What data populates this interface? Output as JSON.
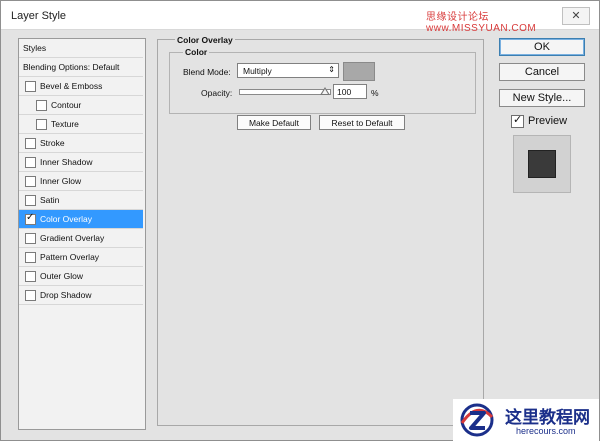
{
  "window": {
    "title": "Layer Style",
    "watermark_text": "思缘设计论坛 www.MISSYUAN.COM",
    "close_glyph": "✕"
  },
  "styles_panel": {
    "items": [
      {
        "label": "Styles",
        "checkbox": false,
        "checked": false,
        "indent": 0,
        "selected": false
      },
      {
        "label": "Blending Options: Default",
        "checkbox": false,
        "checked": false,
        "indent": 0,
        "selected": false
      },
      {
        "label": "Bevel & Emboss",
        "checkbox": true,
        "checked": false,
        "indent": 0,
        "selected": false
      },
      {
        "label": "Contour",
        "checkbox": true,
        "checked": false,
        "indent": 1,
        "selected": false
      },
      {
        "label": "Texture",
        "checkbox": true,
        "checked": false,
        "indent": 1,
        "selected": false
      },
      {
        "label": "Stroke",
        "checkbox": true,
        "checked": false,
        "indent": 0,
        "selected": false
      },
      {
        "label": "Inner Shadow",
        "checkbox": true,
        "checked": false,
        "indent": 0,
        "selected": false
      },
      {
        "label": "Inner Glow",
        "checkbox": true,
        "checked": false,
        "indent": 0,
        "selected": false
      },
      {
        "label": "Satin",
        "checkbox": true,
        "checked": false,
        "indent": 0,
        "selected": false
      },
      {
        "label": "Color Overlay",
        "checkbox": true,
        "checked": true,
        "indent": 0,
        "selected": true
      },
      {
        "label": "Gradient Overlay",
        "checkbox": true,
        "checked": false,
        "indent": 0,
        "selected": false
      },
      {
        "label": "Pattern Overlay",
        "checkbox": true,
        "checked": false,
        "indent": 0,
        "selected": false
      },
      {
        "label": "Outer Glow",
        "checkbox": true,
        "checked": false,
        "indent": 0,
        "selected": false
      },
      {
        "label": "Drop Shadow",
        "checkbox": true,
        "checked": false,
        "indent": 0,
        "selected": false
      }
    ]
  },
  "color_overlay": {
    "group_title": "Color Overlay",
    "subgroup_title": "Color",
    "blend_mode_label": "Blend Mode:",
    "blend_mode_value": "Multiply",
    "overlay_color": "#a8a8a8",
    "opacity_label": "Opacity:",
    "opacity_value": "100",
    "opacity_unit": "%",
    "make_default_label": "Make Default",
    "reset_default_label": "Reset to Default"
  },
  "actions": {
    "ok_label": "OK",
    "cancel_label": "Cancel",
    "new_style_label": "New Style...",
    "preview_label": "Preview",
    "preview_checked": true
  },
  "logo": {
    "title": "这里教程网",
    "subtitle": "herecours.com"
  }
}
